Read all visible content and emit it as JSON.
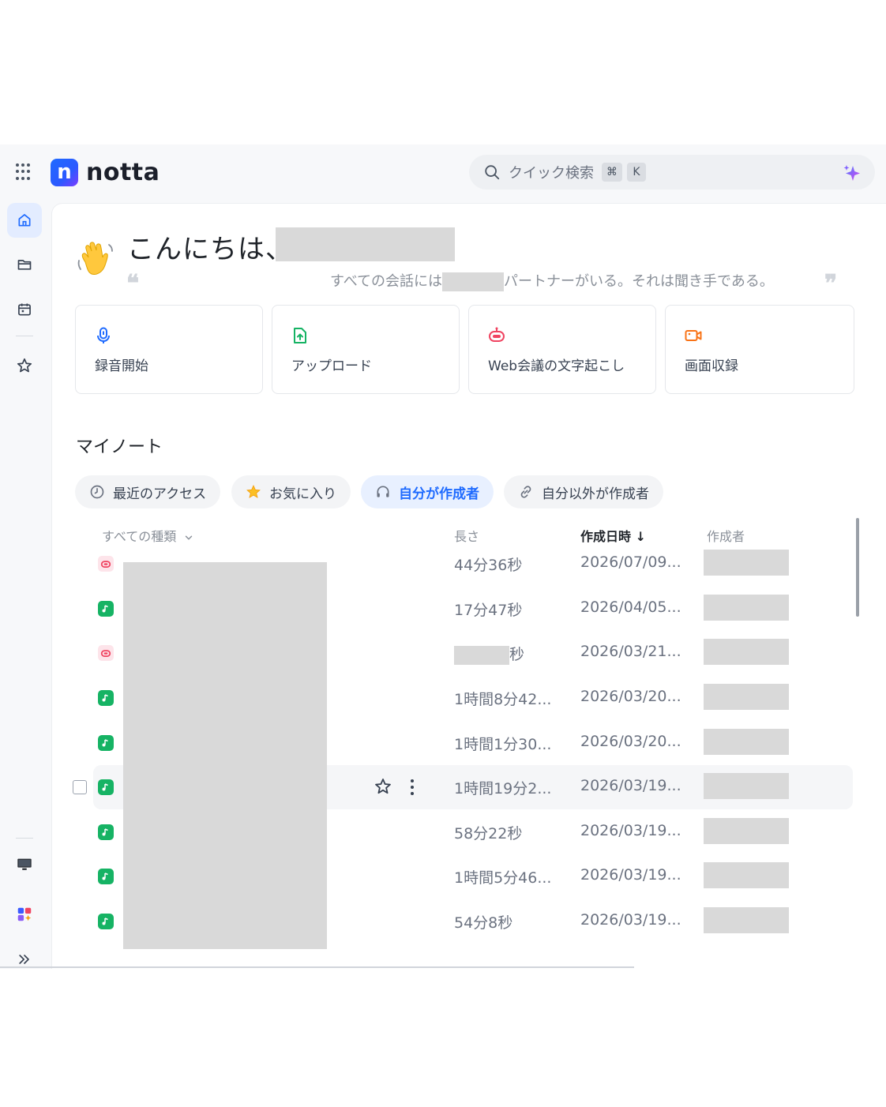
{
  "brand": {
    "logo_letter": "n",
    "name": "notta"
  },
  "search": {
    "placeholder": "クイック検索",
    "shortcut_cmd": "⌘",
    "shortcut_key": "K"
  },
  "sidebar": {
    "items": [
      "home",
      "folder",
      "calendar",
      "favorites"
    ],
    "bottom": [
      "device",
      "apps",
      "expand"
    ]
  },
  "greeting": {
    "title": "こんにちは、",
    "quote_before": "すべての会話には",
    "quote_after": "パートナーがいる。それは聞き手である。",
    "quote_open": "❝",
    "quote_close": "❞"
  },
  "actions": [
    {
      "label": "録音開始",
      "icon": "microphone-icon",
      "color": "#1f6bff"
    },
    {
      "label": "アップロード",
      "icon": "upload-file-icon",
      "color": "#16b364"
    },
    {
      "label": "Web会議の文字起こし",
      "icon": "bot-icon",
      "color": "#f04461"
    },
    {
      "label": "画面収録",
      "icon": "video-camera-icon",
      "color": "#f97316"
    }
  ],
  "notes": {
    "section_title": "マイノート",
    "tabs": [
      {
        "label": "最近のアクセス",
        "icon": "clock-icon",
        "active": false
      },
      {
        "label": "お気に入り",
        "icon": "star-icon",
        "active": false
      },
      {
        "label": "自分が作成者",
        "icon": "headphones-icon",
        "active": true
      },
      {
        "label": "自分以外が作成者",
        "icon": "link-icon",
        "active": false
      }
    ],
    "columns": {
      "type_filter": "すべての種類",
      "length": "長さ",
      "created": "作成日時 ↓",
      "owner": "作成者"
    },
    "rows": [
      {
        "type": "bot",
        "length": "44分36秒",
        "created": "2026/07/09..."
      },
      {
        "type": "audio",
        "length": "17分47秒",
        "created": "2026/04/05..."
      },
      {
        "type": "bot",
        "length": "秒",
        "created": "2026/03/21..."
      },
      {
        "type": "audio",
        "length": "1時間8分42...",
        "created": "2026/03/20..."
      },
      {
        "type": "audio",
        "length": "1時間1分30...",
        "created": "2026/03/20..."
      },
      {
        "type": "audio",
        "length": "1時間19分2...",
        "created": "2026/03/19...",
        "hover": true
      },
      {
        "type": "audio",
        "length": "58分22秒",
        "created": "2026/03/19..."
      },
      {
        "type": "audio",
        "length": "1時間5分46...",
        "created": "2026/03/19..."
      },
      {
        "type": "audio",
        "length": "54分8秒",
        "created": "2026/03/19..."
      }
    ]
  },
  "colors": {
    "accent": "#1f6bff",
    "bot": "#f04461",
    "audio": "#16b364"
  }
}
